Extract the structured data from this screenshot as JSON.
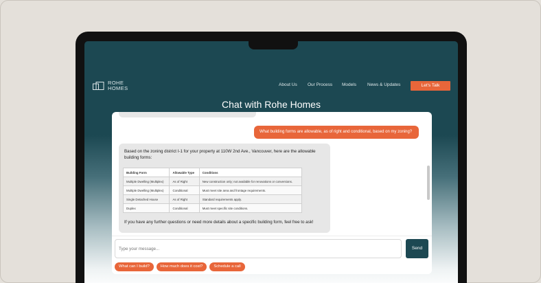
{
  "nav": {
    "logo_line1": "ROHE",
    "logo_line2": "HOMES",
    "items": [
      "About Us",
      "Our Process",
      "Models",
      "News & Updates"
    ],
    "cta": "Let's Talk"
  },
  "page": {
    "title": "Chat with Rohe Homes"
  },
  "chat": {
    "user_message": "What building forms are allowable, as of right and conditional, based on my zoning?",
    "ai_intro": "Based on the zoning district I-1 for your property at 110W 2nd Ave., Vancouver, here are the allowable building forms:",
    "table": {
      "headers": [
        "Building Form",
        "Allowable Type",
        "Conditions"
      ],
      "rows": [
        [
          "Multiple Dwelling (Multiplex)",
          "As of Right",
          "New construction only; not available for renovations or conversions."
        ],
        [
          "Multiple Dwelling (Multiplex)",
          "Conditional",
          "Must meet site area and frontage requirements."
        ],
        [
          "Single Detached House",
          "As of Right",
          "Standard requirements apply."
        ],
        [
          "Duplex",
          "Conditional",
          "Must meet specific site conditions."
        ]
      ]
    },
    "ai_footer": "If you have any further questions or need more details about a specific building form, feel free to ask!",
    "input_placeholder": "Type your message...",
    "send_label": "Send",
    "suggestions": [
      "What can I build?",
      "How much does it cost?",
      "Schedule a call"
    ]
  },
  "colors": {
    "brand_dark": "#1c4852",
    "accent": "#e8663a"
  }
}
